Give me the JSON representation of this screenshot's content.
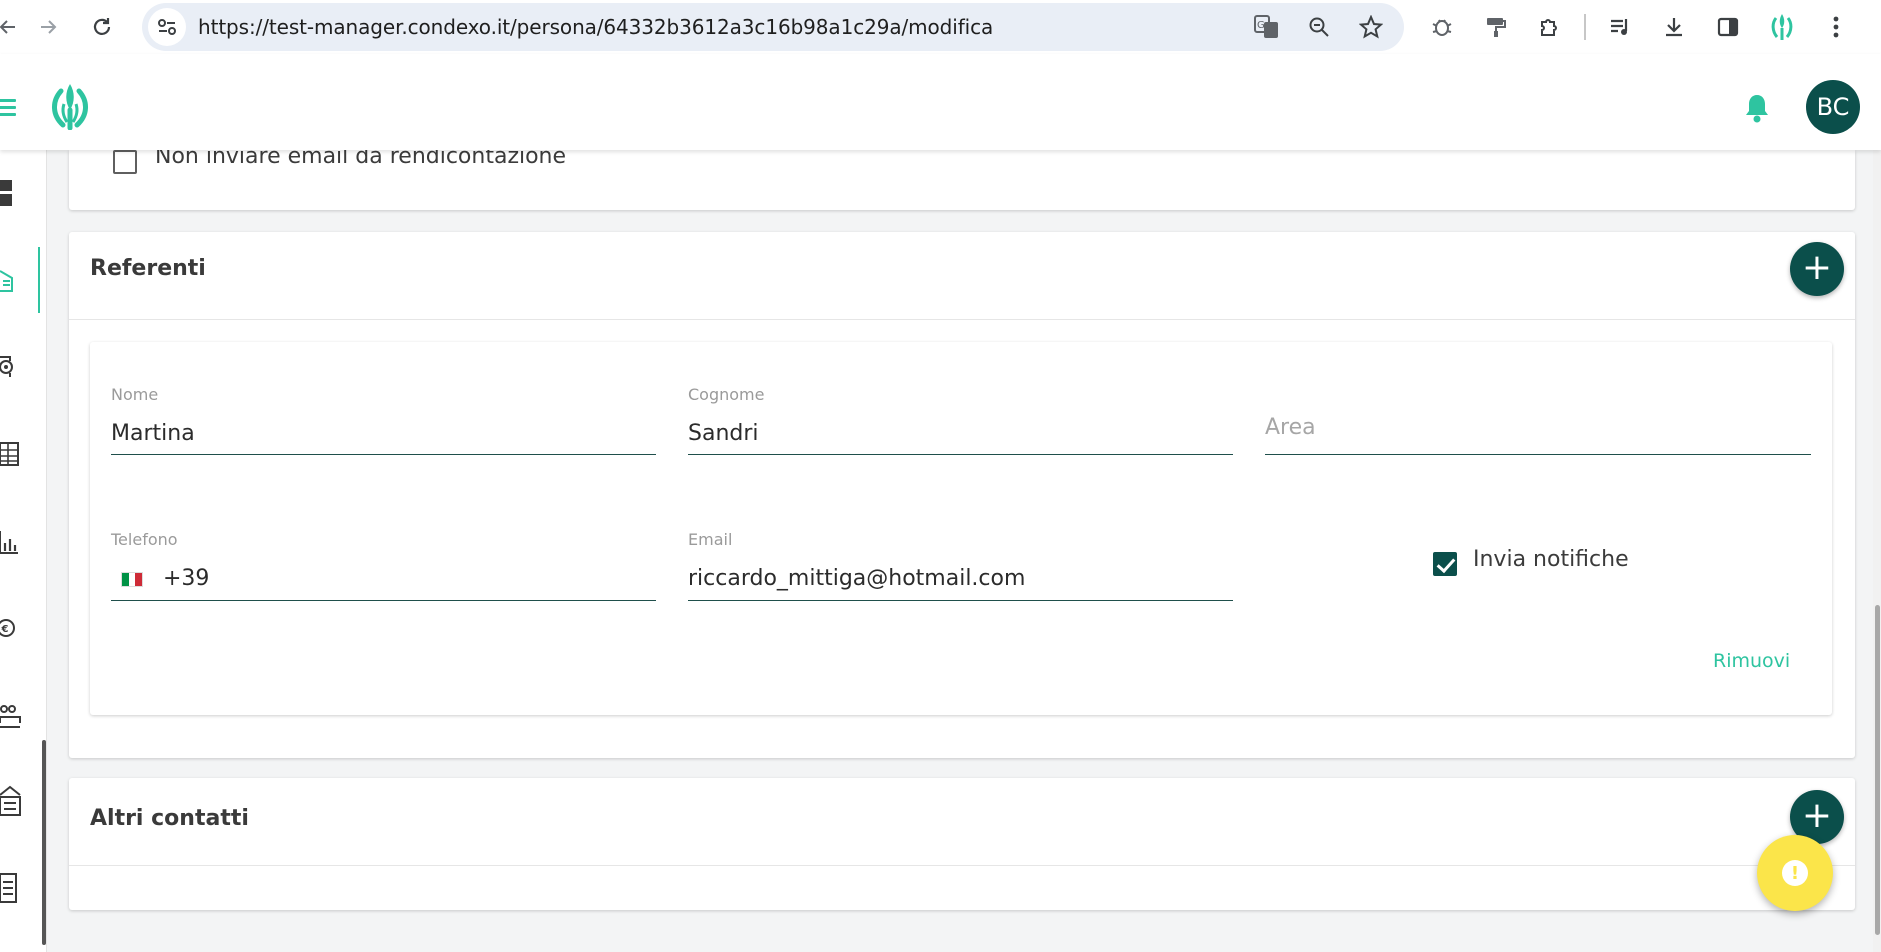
{
  "browser": {
    "url": "https://test-manager.condexo.it/persona/64332b3612a3c16b98a1c29a/modifica"
  },
  "header": {
    "avatar_initials": "BC"
  },
  "top_card": {
    "checkbox_label": "Non inviare email da rendicontazione"
  },
  "referenti": {
    "title": "Referenti",
    "contact": {
      "nome_label": "Nome",
      "nome_value": "Martina",
      "cognome_label": "Cognome",
      "cognome_value": "Sandri",
      "area_placeholder": "Area",
      "telefono_label": "Telefono",
      "telefono_prefix": "+39",
      "email_label": "Email",
      "email_value": "riccardo_mittiga@hotmail.com",
      "notifiche_label": "Invia notifiche",
      "notifiche_checked": true,
      "remove_label": "Rimuovi"
    }
  },
  "altri_contatti": {
    "title": "Altri contatti"
  },
  "colors": {
    "accent": "#2ec4a0",
    "primary": "#0b4f4b",
    "warning": "#fbe54a"
  },
  "icons": {
    "fab_add": "+",
    "warning": "!"
  }
}
